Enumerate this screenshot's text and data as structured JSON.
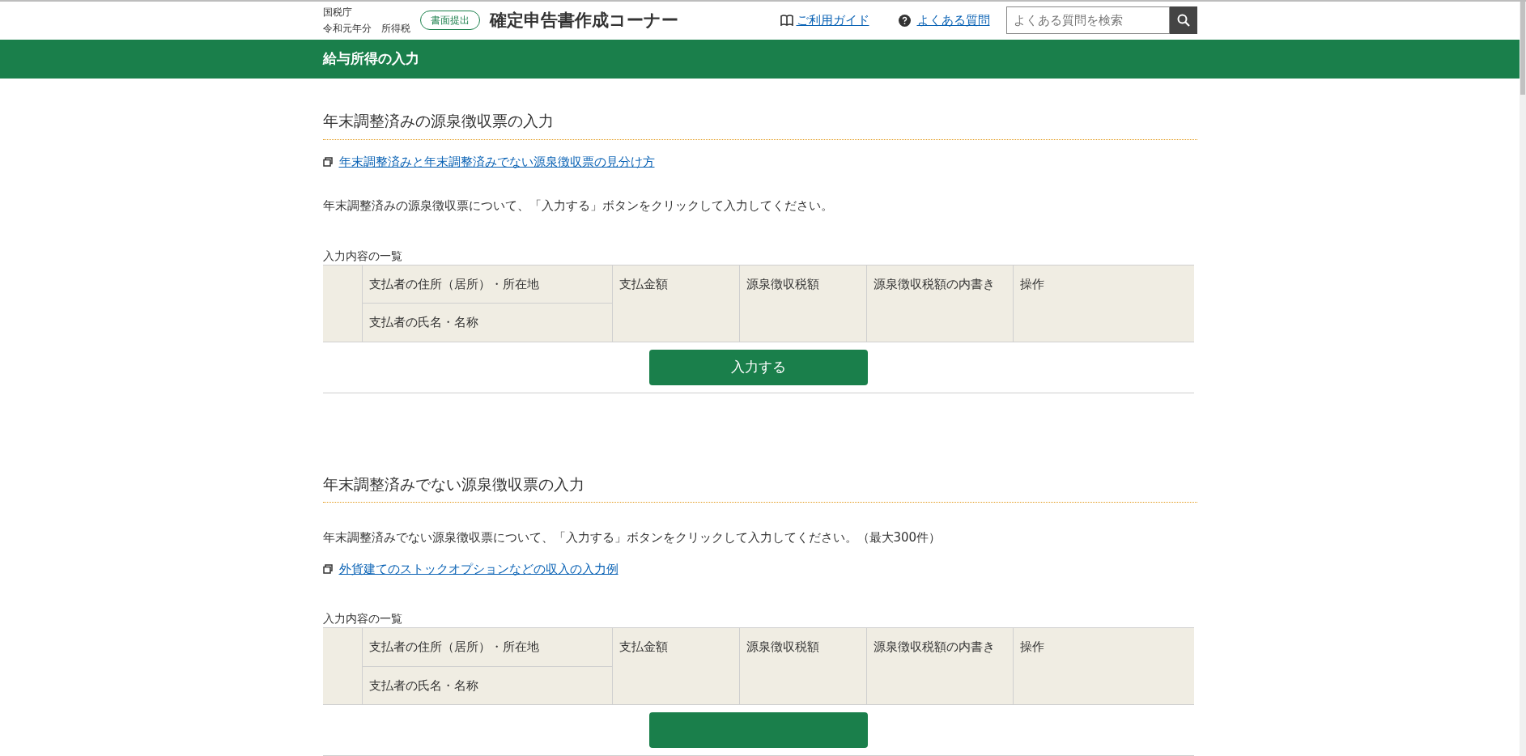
{
  "header": {
    "agency": "国税庁",
    "year": "令和元年分　所得税",
    "badge": "書面提出",
    "title": "確定申告書作成コーナー",
    "guide_link": "ご利用ガイド",
    "faq_link": "よくある質問",
    "search": {
      "placeholder": "よくある質問を検索"
    }
  },
  "page_title": "給与所得の入力",
  "sections": [
    {
      "title": "年末調整済みの源泉徴収票の入力",
      "blocks": [
        {
          "kind": "link",
          "text": "年末調整済みと年末調整済みでない源泉徴収票の見分け方"
        },
        {
          "kind": "text",
          "text": "年末調整済みの源泉徴収票について、「入力する」ボタンをクリックして入力してください。"
        }
      ],
      "table": {
        "caption": "入力内容の一覧",
        "address_header": "支払者の住所（居所）・所在地",
        "name_header": "支払者の氏名・名称",
        "columns": [
          "支払金額",
          "源泉徴収税額",
          "源泉徴収税額の内書き",
          "操作"
        ]
      },
      "button": "入力する"
    },
    {
      "title": "年末調整済みでない源泉徴収票の入力",
      "blocks": [
        {
          "kind": "text",
          "text": "年末調整済みでない源泉徴収票について、「入力する」ボタンをクリックして入力してください。（最大300件）"
        },
        {
          "kind": "link",
          "text": "外貨建てのストックオプションなどの収入の入力例"
        }
      ],
      "table": {
        "caption": "入力内容の一覧",
        "address_header": "支払者の住所（居所）・所在地",
        "name_header": "支払者の氏名・名称",
        "columns": [
          "支払金額",
          "源泉徴収税額",
          "源泉徴収税額の内書き",
          "操作"
        ]
      }
    }
  ]
}
